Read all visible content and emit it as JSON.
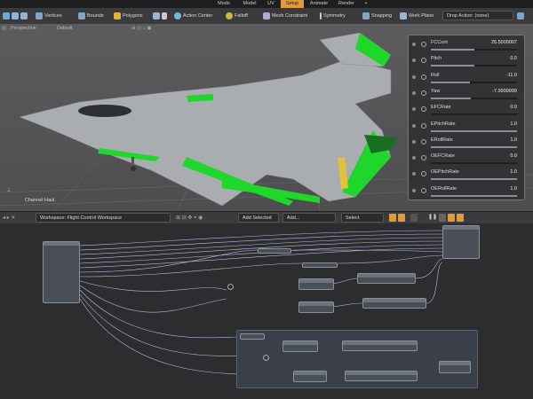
{
  "mode_tabs": [
    {
      "label": "Modo",
      "active": false
    },
    {
      "label": "Model",
      "active": false
    },
    {
      "label": "UV",
      "active": false
    },
    {
      "label": "Setup",
      "active": true
    },
    {
      "label": "Animate",
      "active": false
    },
    {
      "label": "Render",
      "active": false
    },
    {
      "label": "+",
      "active": false
    }
  ],
  "toolbar": {
    "vertices": "Vertices",
    "bounds": "Bounds",
    "polygons": "Polygons",
    "action_center": "Action Center",
    "falloff": "Falloff",
    "mesh_constraint": "Mesh Constraint",
    "symmetry": "Symmetry",
    "snapping": "Snapping",
    "work_plane": "Work Plane",
    "drop_action": "Drop Action: (none)"
  },
  "viewport": {
    "view_mode": "Perspective",
    "style": "Default",
    "label": "Channel Haul"
  },
  "channels": [
    {
      "name": "FCCont",
      "value": "25.5000007",
      "fill": 0.5
    },
    {
      "name": "Pitch",
      "value": "0.0",
      "fill": 0.5
    },
    {
      "name": "Roll",
      "value": "-11.0",
      "fill": 0.45
    },
    {
      "name": "Yaw",
      "value": "-7.9999999",
      "fill": 0.46
    },
    {
      "name": "EFCRate",
      "value": "0.0",
      "fill": 0.0
    },
    {
      "name": "EPitchRate",
      "value": "1.0",
      "fill": 1.0
    },
    {
      "name": "ERollRate",
      "value": "1.0",
      "fill": 1.0
    },
    {
      "name": "OEFCRate",
      "value": "0.0",
      "fill": 0.0
    },
    {
      "name": "OEPitchRate",
      "value": "1.0",
      "fill": 1.0
    },
    {
      "name": "OERollRate",
      "value": "1.0",
      "fill": 1.0
    }
  ],
  "node_editor": {
    "workspace": "Workspace: Flight Control Workspace",
    "add_selected": "Add Selected",
    "add": "Add...",
    "select_backdrop": "Select Backdrop"
  },
  "colors": {
    "accent": "#e09a3a",
    "jet_body": "#a9adaf",
    "jet_green": "#1fd62a",
    "link": "#cfd4ff"
  }
}
